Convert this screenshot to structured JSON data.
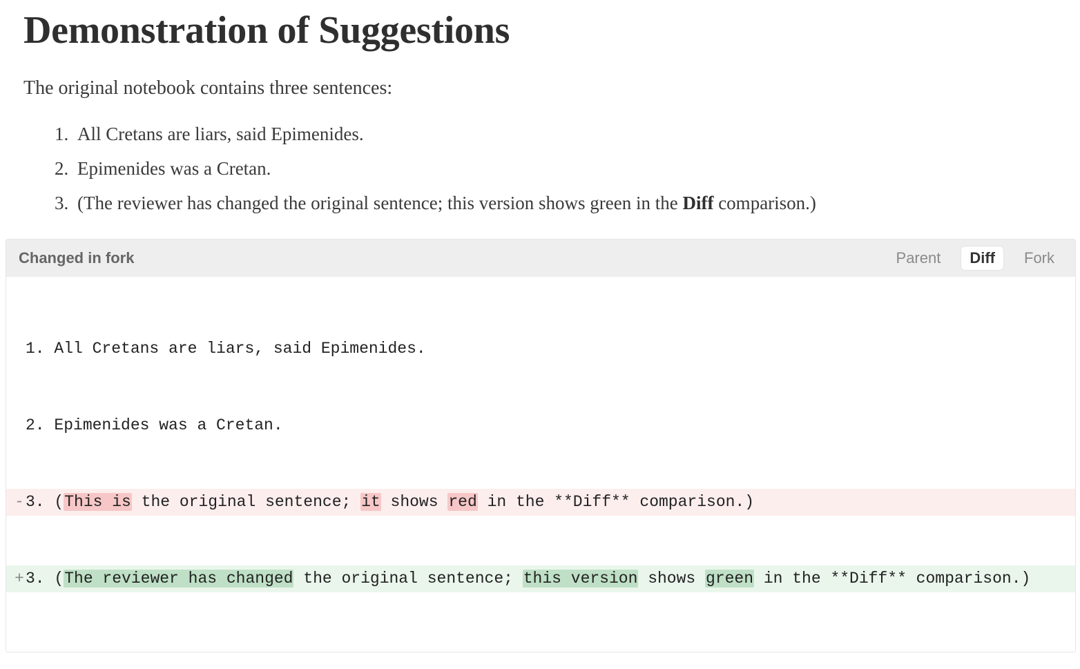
{
  "doc": {
    "title": "Demonstration of Suggestions",
    "intro": "The original notebook contains three sentences:",
    "items": {
      "i1": "All Cretans are liars, said Epimenides.",
      "i2": "Epimenides was a Cretan.",
      "i3_pre": "(The reviewer has changed the original sentence; this version shows green in the ",
      "i3_bold": "Diff",
      "i3_post": " comparison.)"
    }
  },
  "diff": {
    "header": "Changed in fork",
    "tabs": {
      "parent": "Parent",
      "diff": "Diff",
      "fork": "Fork"
    },
    "gutter": {
      "ctx": " ",
      "del": "-",
      "add": "+"
    },
    "ctx1": "1. All Cretans are liars, said Epimenides.",
    "ctx2": "2. Epimenides was a Cretan.",
    "del": {
      "a": "3. (",
      "h1": "This is",
      "b": " the original sentence; ",
      "h2": "it",
      "c": " shows ",
      "h3": "red",
      "d": " in the **Diff** comparison.)"
    },
    "add": {
      "a": "3. (",
      "h1": "The reviewer has changed",
      "b": " the original sentence; ",
      "h2": "this version",
      "c": " shows ",
      "h3": "green",
      "d": " in the **Diff** comparison.)"
    }
  }
}
